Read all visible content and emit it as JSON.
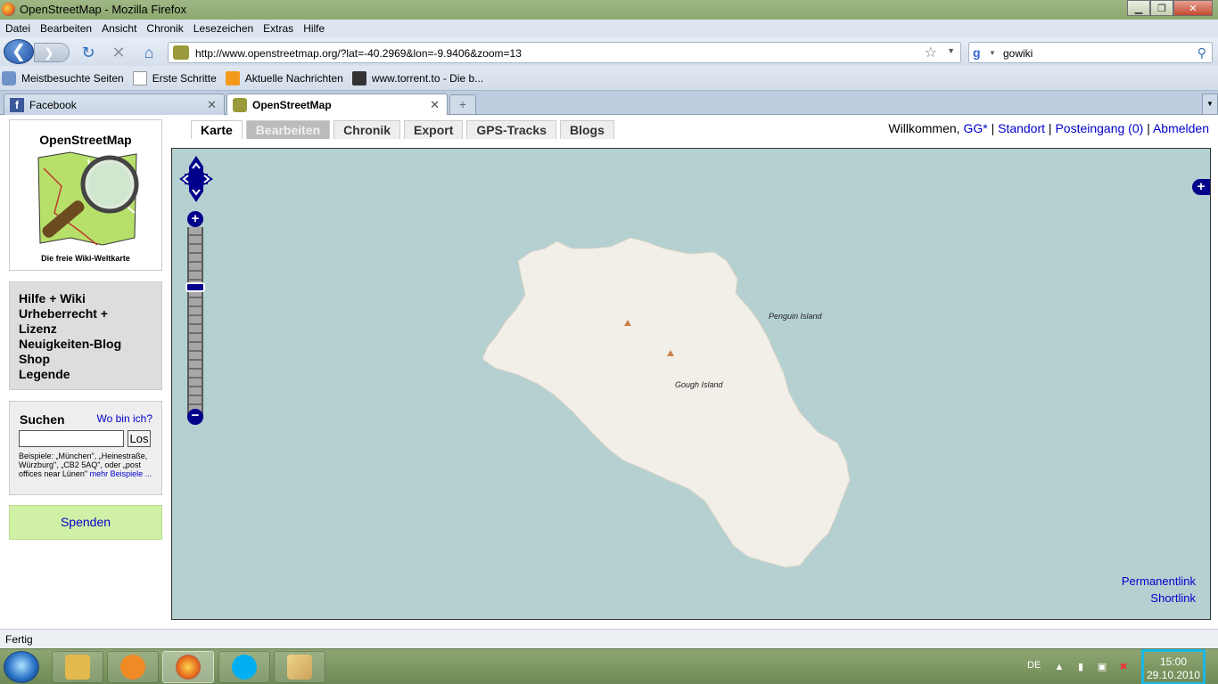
{
  "window": {
    "title": "OpenStreetMap - Mozilla Firefox",
    "min_glyph": "▁",
    "max_glyph": "❐",
    "close_glyph": "✕"
  },
  "menu": [
    "Datei",
    "Bearbeiten",
    "Ansicht",
    "Chronik",
    "Lesezeichen",
    "Extras",
    "Hilfe"
  ],
  "nav": {
    "url": "http://www.openstreetmap.org/?lat=-40.2969&lon=-9.9406&zoom=13",
    "search_query": "gowiki",
    "back_glyph": "❮",
    "forward_glyph": "❯",
    "reload_glyph": "↻",
    "stop_glyph": "✕",
    "home_glyph": "⌂",
    "star_glyph": "☆",
    "magnifier_glyph": "⚲"
  },
  "bookmarks": [
    {
      "label": "Meistbesuchte Seiten",
      "icon": "gear-icon"
    },
    {
      "label": "Erste Schritte",
      "icon": "page-icon"
    },
    {
      "label": "Aktuelle Nachrichten",
      "icon": "rss-icon"
    },
    {
      "label": "www.torrent.to - Die b...",
      "icon": "tv-icon"
    }
  ],
  "tabs": [
    {
      "label": "Facebook",
      "active": false
    },
    {
      "label": "OpenStreetMap",
      "active": true
    }
  ],
  "sidebar": {
    "logo_name": "OpenStreetMap",
    "logo_tagline": "Die freie Wiki-Weltkarte",
    "links": [
      "Hilfe + Wiki",
      "Urheberrecht +",
      "Lizenz",
      "Neuigkeiten-Blog",
      "Shop",
      "Legende"
    ],
    "search": {
      "heading": "Suchen",
      "where_link": "Wo bin ich?",
      "button": "Los",
      "examples": "Beispiele: „München\", „Heinestraße, Würzburg\", „CB2 5AQ\", oder „post offices near Lünen\"",
      "more_link": "mehr Beispiele ..."
    },
    "donate": "Spenden"
  },
  "site_tabs": [
    {
      "label": "Karte",
      "state": "active"
    },
    {
      "label": "Bearbeiten",
      "state": "disabled"
    },
    {
      "label": "Chronik",
      "state": "normal"
    },
    {
      "label": "Export",
      "state": "normal"
    },
    {
      "label": "GPS-Tracks",
      "state": "normal"
    },
    {
      "label": "Blogs",
      "state": "normal"
    }
  ],
  "user": {
    "welcome": "Willkommen,",
    "name": "GG*",
    "location": "Standort",
    "inbox": "Posteingang (0)",
    "logout": "Abmelden",
    "sep": "|"
  },
  "map": {
    "labels": {
      "penguin": "Penguin Island",
      "gough": "Gough Island"
    },
    "permalink": "Permanentlink",
    "shortlink": "Shortlink",
    "plus_glyph": "+",
    "minus_glyph": "−",
    "colors": {
      "water": "#b5d0d0",
      "land": "#f2efe9",
      "controls": "#00008b",
      "peak": "#c8804a"
    }
  },
  "status": "Fertig",
  "taskbar": {
    "apps": [
      "explorer-icon",
      "media-player-icon",
      "firefox-icon",
      "skype-icon",
      "paint-icon"
    ],
    "lang": "DE",
    "time": "15:00",
    "date": "29.10.2010"
  }
}
